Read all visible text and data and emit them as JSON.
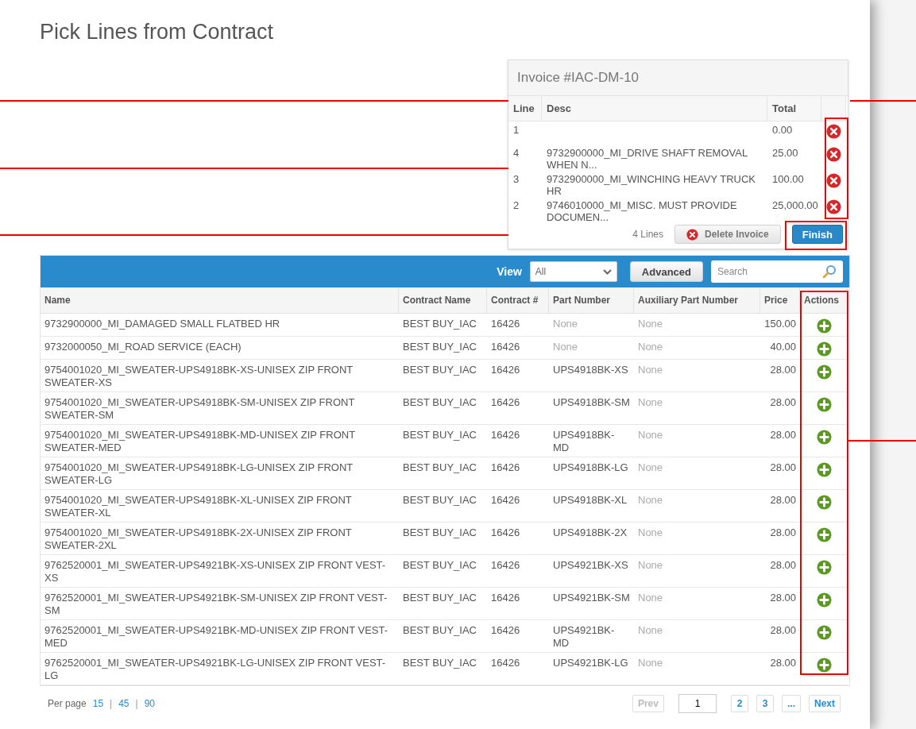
{
  "page_title": "Pick Lines from Contract",
  "invoice": {
    "title": "Invoice #IAC-DM-10",
    "columns": [
      "Line",
      "Desc",
      "Total"
    ],
    "lines": [
      {
        "line": "1",
        "total": "0.00"
      },
      {
        "line": "4",
        "desc": "9732900000_MI_DRIVE SHAFT REMOVAL WHEN N...",
        "total": "25.00"
      },
      {
        "line": "3",
        "desc": "9732900000_MI_WINCHING HEAVY TRUCK HR",
        "total": "100.00"
      },
      {
        "line": "2",
        "desc": "9746010000_MI_MISC. MUST PROVIDE DOCUMEN...",
        "total": "25,000.00"
      }
    ],
    "count": "4 Lines",
    "delete_label": "Delete Invoice",
    "finish_label": "Finish"
  },
  "toolbar": {
    "view_label": "View",
    "view_value": "All",
    "advanced_label": "Advanced",
    "search_placeholder": "Search"
  },
  "table": {
    "columns": [
      "Name",
      "Contract Name",
      "Contract #",
      "Part Number",
      "Auxiliary Part Number",
      "Price",
      "Actions"
    ],
    "rows": [
      {
        "name": "9732900000_MI_DAMAGED SMALL FLATBED HR",
        "contract_name": "BEST BUY_IAC",
        "contract_no": "16426",
        "part_number": "None",
        "part_missing": true,
        "aux": "None",
        "aux_missing": true,
        "price": "150.00"
      },
      {
        "name": "9732000050_MI_ROAD SERVICE (EACH)",
        "contract_name": "BEST BUY_IAC",
        "contract_no": "16426",
        "part_number": "None",
        "part_missing": true,
        "aux": "None",
        "aux_missing": true,
        "price": "40.00"
      },
      {
        "name": "9754001020_MI_SWEATER-UPS4918BK-XS-UNISEX ZIP FRONT SWEATER-XS",
        "contract_name": "BEST BUY_IAC",
        "contract_no": "16426",
        "part_number": "UPS4918BK-XS",
        "part_missing": false,
        "aux": "None",
        "aux_missing": true,
        "price": "28.00"
      },
      {
        "name": "9754001020_MI_SWEATER-UPS4918BK-SM-UNISEX ZIP FRONT SWEATER-SM",
        "contract_name": "BEST BUY_IAC",
        "contract_no": "16426",
        "part_number": "UPS4918BK-SM",
        "part_missing": false,
        "aux": "None",
        "aux_missing": true,
        "price": "28.00"
      },
      {
        "name": "9754001020_MI_SWEATER-UPS4918BK-MD-UNISEX ZIP FRONT SWEATER-MED",
        "contract_name": "BEST BUY_IAC",
        "contract_no": "16426",
        "part_number": "UPS4918BK-MD",
        "part_missing": false,
        "aux": "None",
        "aux_missing": true,
        "price": "28.00"
      },
      {
        "name": "9754001020_MI_SWEATER-UPS4918BK-LG-UNISEX ZIP FRONT SWEATER-LG",
        "contract_name": "BEST BUY_IAC",
        "contract_no": "16426",
        "part_number": "UPS4918BK-LG",
        "part_missing": false,
        "aux": "None",
        "aux_missing": true,
        "price": "28.00"
      },
      {
        "name": "9754001020_MI_SWEATER-UPS4918BK-XL-UNISEX ZIP FRONT SWEATER-XL",
        "contract_name": "BEST BUY_IAC",
        "contract_no": "16426",
        "part_number": "UPS4918BK-XL",
        "part_missing": false,
        "aux": "None",
        "aux_missing": true,
        "price": "28.00"
      },
      {
        "name": "9754001020_MI_SWEATER-UPS4918BK-2X-UNISEX ZIP FRONT SWEATER-2XL",
        "contract_name": "BEST BUY_IAC",
        "contract_no": "16426",
        "part_number": "UPS4918BK-2X",
        "part_missing": false,
        "aux": "None",
        "aux_missing": true,
        "price": "28.00"
      },
      {
        "name": "9762520001_MI_SWEATER-UPS4921BK-XS-UNISEX ZIP FRONT VEST-XS",
        "contract_name": "BEST BUY_IAC",
        "contract_no": "16426",
        "part_number": "UPS4921BK-XS",
        "part_missing": false,
        "aux": "None",
        "aux_missing": true,
        "price": "28.00"
      },
      {
        "name": "9762520001_MI_SWEATER-UPS4921BK-SM-UNISEX ZIP FRONT VEST-SM",
        "contract_name": "BEST BUY_IAC",
        "contract_no": "16426",
        "part_number": "UPS4921BK-SM",
        "part_missing": false,
        "aux": "None",
        "aux_missing": true,
        "price": "28.00"
      },
      {
        "name": "9762520001_MI_SWEATER-UPS4921BK-MD-UNISEX ZIP FRONT VEST-MED",
        "contract_name": "BEST BUY_IAC",
        "contract_no": "16426",
        "part_number": "UPS4921BK-MD",
        "part_missing": false,
        "aux": "None",
        "aux_missing": true,
        "price": "28.00"
      },
      {
        "name": "9762520001_MI_SWEATER-UPS4921BK-LG-UNISEX ZIP FRONT VEST-LG",
        "contract_name": "BEST BUY_IAC",
        "contract_no": "16426",
        "part_number": "UPS4921BK-LG",
        "part_missing": false,
        "aux": "None",
        "aux_missing": true,
        "price": "28.00"
      }
    ]
  },
  "pagination": {
    "per_page_label": "Per page",
    "separator": "|",
    "per_page_options": [
      {
        "label": "15"
      },
      {
        "label": "45"
      },
      {
        "label": "90"
      }
    ],
    "prev": {
      "label": "Prev",
      "disabled": true
    },
    "current_page": "1",
    "pages": [
      "2",
      "3"
    ],
    "ellipsis": "...",
    "next": {
      "label": "Next",
      "disabled": false
    }
  }
}
